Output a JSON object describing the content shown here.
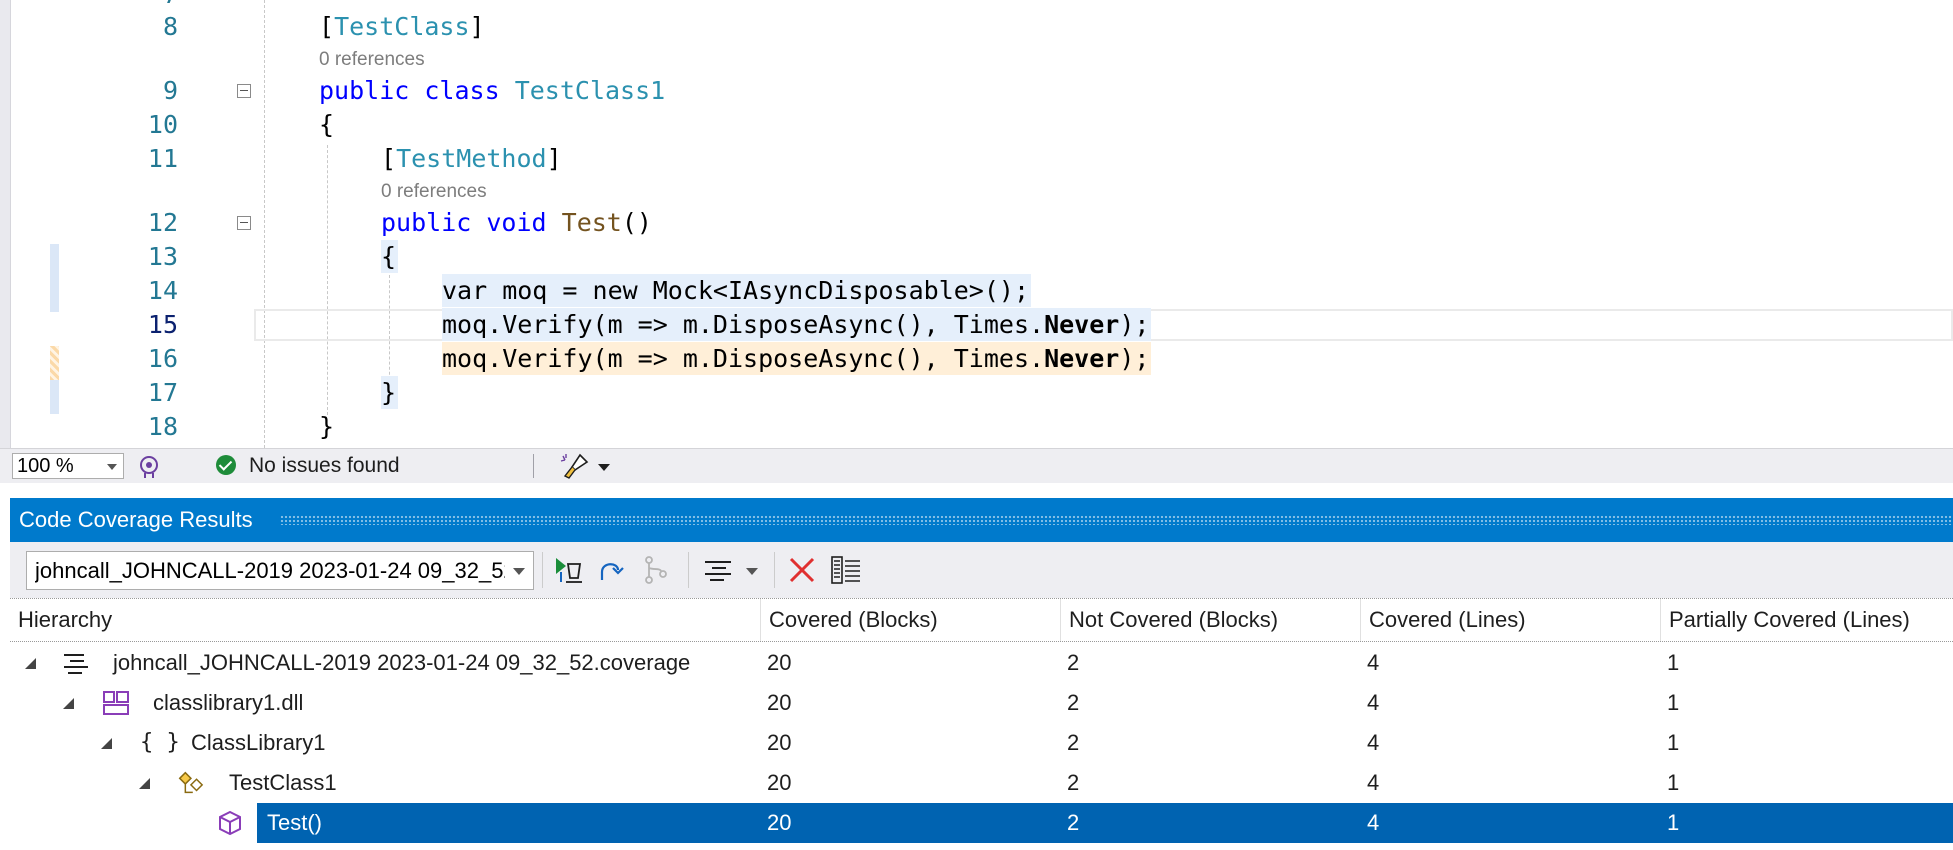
{
  "editor": {
    "lines": [
      {
        "n": "8",
        "code_tokens": [
          {
            "t": "[",
            "c": ""
          },
          {
            "t": "TestClass",
            "c": "ty"
          },
          {
            "t": "]",
            "c": ""
          }
        ]
      },
      {
        "n": "9",
        "code_tokens": [
          {
            "t": "public",
            "c": "kw"
          },
          {
            "t": " ",
            "c": ""
          },
          {
            "t": "class",
            "c": "kw"
          },
          {
            "t": " ",
            "c": ""
          },
          {
            "t": "TestClass1",
            "c": "ty"
          }
        ]
      },
      {
        "n": "10",
        "code_tokens": [
          {
            "t": "{",
            "c": ""
          }
        ]
      },
      {
        "n": "11",
        "code_tokens": [
          {
            "t": "[",
            "c": ""
          },
          {
            "t": "TestMethod",
            "c": "ty"
          },
          {
            "t": "]",
            "c": ""
          }
        ]
      },
      {
        "n": "12",
        "code_tokens": [
          {
            "t": "public",
            "c": "kw"
          },
          {
            "t": " ",
            "c": ""
          },
          {
            "t": "void",
            "c": "kw"
          },
          {
            "t": " ",
            "c": ""
          },
          {
            "t": "Test",
            "c": "fn"
          },
          {
            "t": "()",
            "c": ""
          }
        ]
      },
      {
        "n": "13",
        "code_tokens": [
          {
            "t": "{",
            "c": ""
          }
        ]
      },
      {
        "n": "14",
        "code_tokens": [
          {
            "t": "var moq = new Mock<IAsyncDisposable>();",
            "c": ""
          }
        ]
      },
      {
        "n": "15",
        "code_tokens": [
          {
            "t": "moq.Verify(m => m.DisposeAsync(), Times.",
            "c": ""
          },
          {
            "t": "Never",
            "c": "bold"
          },
          {
            "t": ");",
            "c": ""
          }
        ]
      },
      {
        "n": "16",
        "code_tokens": [
          {
            "t": "moq.Verify(m => m.DisposeAsync(), Times.",
            "c": ""
          },
          {
            "t": "Never",
            "c": "bold"
          },
          {
            "t": ");",
            "c": ""
          }
        ]
      },
      {
        "n": "17",
        "code_tokens": [
          {
            "t": "}",
            "c": ""
          }
        ]
      },
      {
        "n": "18",
        "code_tokens": [
          {
            "t": "}",
            "c": ""
          }
        ]
      }
    ],
    "codelens_1": "0 references",
    "codelens_2": "0 references"
  },
  "statusbar": {
    "zoom": "100 %",
    "issues": "No issues found"
  },
  "panel": {
    "title": "Code Coverage Results",
    "combo_value": "johncall_JOHNCALL-2019 2023-01-24 09_32_52.coverage",
    "columns": [
      "Hierarchy",
      "Covered (Blocks)",
      "Not Covered (Blocks)",
      "Covered (Lines)",
      "Partially Covered (Lines)"
    ],
    "rows": [
      {
        "name": "johncall_JOHNCALL-2019 2023-01-24 09_32_52.coverage",
        "covered_blocks": "20",
        "not_covered_blocks": "2",
        "covered_lines": "4",
        "partial_lines": "1"
      },
      {
        "name": "classlibrary1.dll",
        "covered_blocks": "20",
        "not_covered_blocks": "2",
        "covered_lines": "4",
        "partial_lines": "1"
      },
      {
        "name": "ClassLibrary1",
        "covered_blocks": "20",
        "not_covered_blocks": "2",
        "covered_lines": "4",
        "partial_lines": "1"
      },
      {
        "name": "TestClass1",
        "covered_blocks": "20",
        "not_covered_blocks": "2",
        "covered_lines": "4",
        "partial_lines": "1"
      },
      {
        "name": "Test()",
        "covered_blocks": "20",
        "not_covered_blocks": "2",
        "covered_lines": "4",
        "partial_lines": "1"
      }
    ]
  },
  "icons": {
    "namespace_glyph": "{ }"
  }
}
